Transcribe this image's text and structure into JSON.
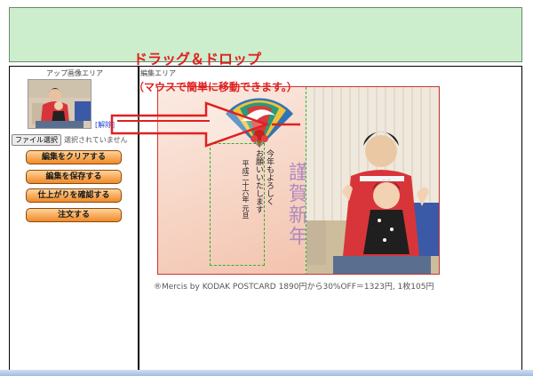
{
  "overlay": {
    "drag_title": "ドラッグ＆ドロップ",
    "drag_subtitle": "（マウスで簡単に移動できます。）"
  },
  "sidebar": {
    "title": "アップ画像エリア",
    "release_link": "[解除]",
    "file_button_label": "ファイル選択",
    "file_status": "選択されていません",
    "buttons": [
      {
        "label": "編集をクリアする"
      },
      {
        "label": "編集を保存する"
      },
      {
        "label": "仕上がりを確認する"
      },
      {
        "label": "注文する"
      }
    ]
  },
  "editor": {
    "label": "編集エリア",
    "card": {
      "greeting_big": "謹賀新年",
      "message_lines": [
        "今年もよろしく",
        "お願いいたします",
        "平成二十六年 元旦"
      ]
    },
    "caption": "®Mercis by KODAK POSTCARD 1890円から30%OFF＝1323円, 1枚105円"
  },
  "colors": {
    "banner": "#cdeecd",
    "accent_red": "#e02020",
    "button_orange": "#f08a28"
  }
}
